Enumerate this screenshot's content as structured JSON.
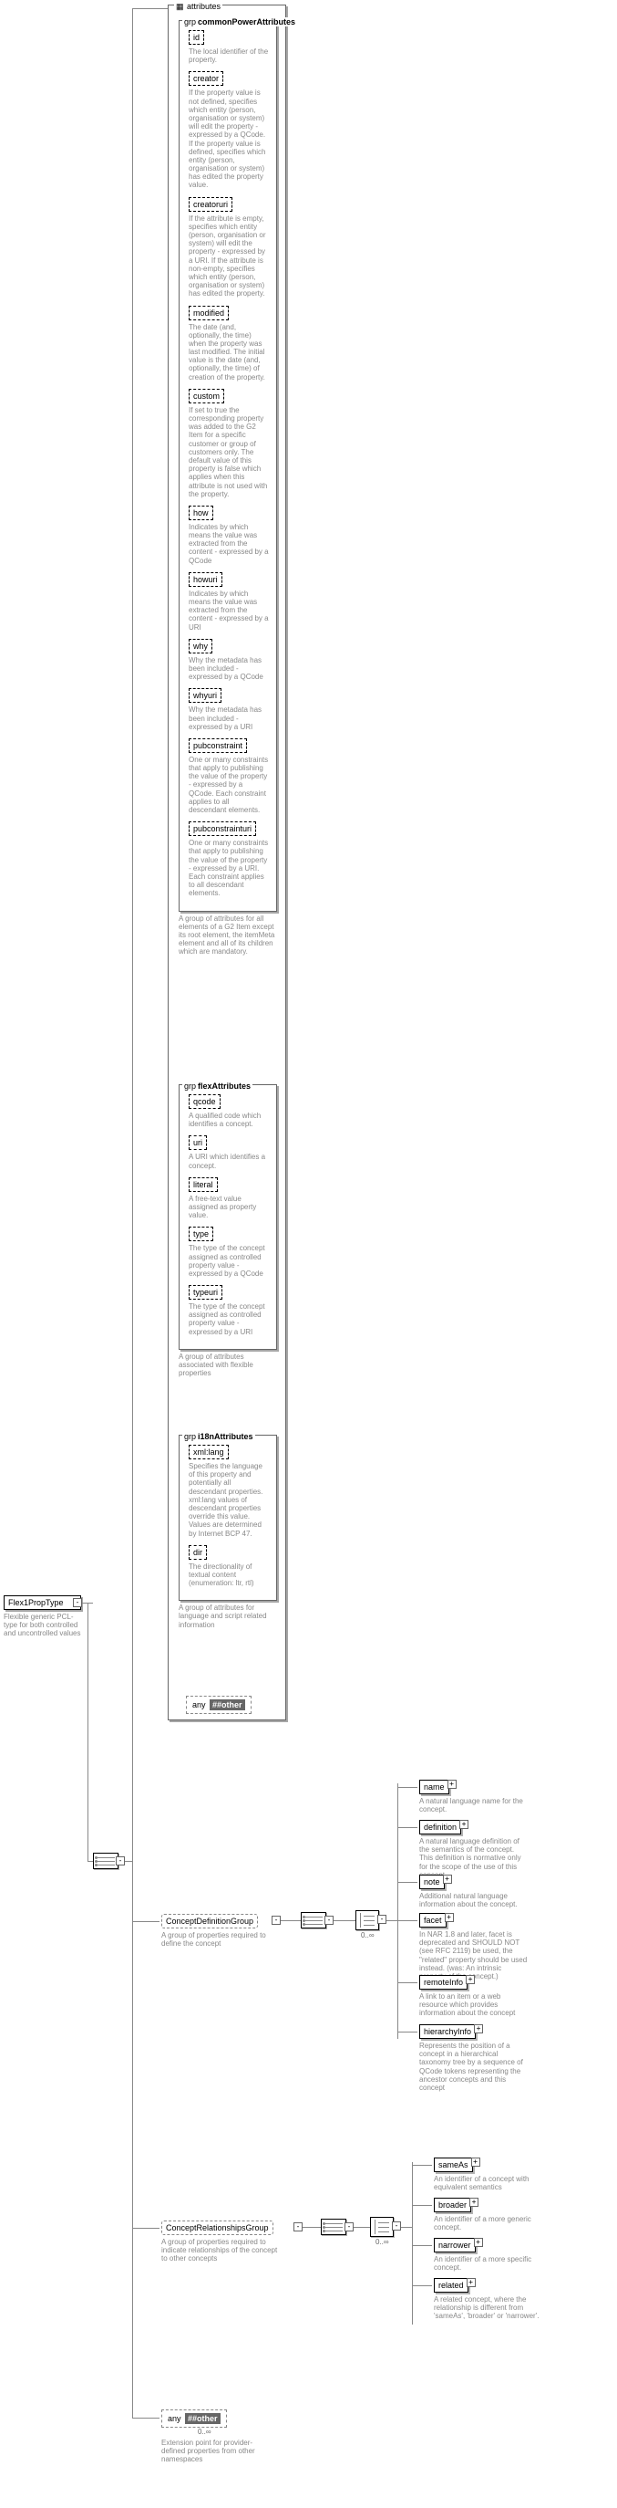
{
  "root": {
    "name": "Flex1PropType",
    "desc": "Flexible generic PCL-type for both controlled and uncontrolled values"
  },
  "attributesLabel": "attributes",
  "toggle": {
    "plus": "+",
    "minus": "-"
  },
  "groups": {
    "common": {
      "prefix": "grp",
      "name": "commonPowerAttributes",
      "desc": "A group of attributes for all elements of a G2 Item except its root element, the itemMeta element and all of its children which are mandatory.",
      "items": [
        {
          "name": "id",
          "desc": "The local identifier of the property."
        },
        {
          "name": "creator",
          "desc": "If the property value is not defined, specifies which entity (person, organisation or system) will edit the property - expressed by a QCode. If the property value is defined, specifies which entity (person, organisation or system) has edited the property value."
        },
        {
          "name": "creatoruri",
          "desc": "If the attribute is empty, specifies which entity (person, organisation or system) will edit the property - expressed by a URI. If the attribute is non-empty, specifies which entity (person, organisation or system) has edited the property."
        },
        {
          "name": "modified",
          "desc": "The date (and, optionally, the time) when the property was last modified. The initial value is the date (and, optionally, the time) of creation of the property."
        },
        {
          "name": "custom",
          "desc": "If set to true the corresponding property was added to the G2 Item for a specific customer or group of customers only. The default value of this property is false which applies when this attribute is not used with the property."
        },
        {
          "name": "how",
          "desc": "Indicates by which means the value was extracted from the content - expressed by a QCode"
        },
        {
          "name": "howuri",
          "desc": "Indicates by which means the value was extracted from the content - expressed by a URI"
        },
        {
          "name": "why",
          "desc": "Why the metadata has been included - expressed by a QCode"
        },
        {
          "name": "whyuri",
          "desc": "Why the metadata has been included - expressed by a URI"
        },
        {
          "name": "pubconstraint",
          "desc": "One or many constraints that apply to publishing the value of the property - expressed by a QCode. Each constraint applies to all descendant elements."
        },
        {
          "name": "pubconstrainturi",
          "desc": "One or many constraints that apply to publishing the value of the property - expressed by a URI. Each constraint applies to all descendant elements."
        }
      ]
    },
    "flex": {
      "prefix": "grp",
      "name": "flexAttributes",
      "desc": "A group of attributes associated with flexible properties",
      "items": [
        {
          "name": "qcode",
          "desc": "A qualified code which identifies a concept."
        },
        {
          "name": "uri",
          "desc": "A URI which identifies a concept."
        },
        {
          "name": "literal",
          "desc": "A free-text value assigned as property value."
        },
        {
          "name": "type",
          "desc": "The type of the concept assigned as controlled property value - expressed by a QCode"
        },
        {
          "name": "typeuri",
          "desc": "The type of the concept assigned as controlled property value - expressed by a URI"
        }
      ]
    },
    "i18n": {
      "prefix": "grp",
      "name": "i18nAttributes",
      "desc": "A group of attributes for language and script related information",
      "items": [
        {
          "name": "xml:lang",
          "desc": "Specifies the language of this property and potentially all descendant properties. xml:lang values of descendant properties override this value. Values are determined by Internet BCP 47."
        },
        {
          "name": "dir",
          "desc": "The directionality of textual content (enumeration: ltr, rtl)"
        }
      ]
    }
  },
  "anyOther": {
    "label": "##other",
    "prefix": "any"
  },
  "conceptDef": {
    "name": "ConceptDefinitionGroup",
    "desc": "A group of properties required to define the concept",
    "card": "0..∞",
    "items": [
      {
        "name": "name",
        "desc": "A natural language name for the concept."
      },
      {
        "name": "definition",
        "desc": "A natural language definition of the semantics of the concept. This definition is normative only for the scope of the use of this concept."
      },
      {
        "name": "note",
        "desc": "Additional natural language information about the concept."
      },
      {
        "name": "facet",
        "desc": "In NAR 1.8 and later, facet is deprecated and SHOULD NOT (see RFC 2119) be used, the \"related\" property should be used instead. (was: An intrinsic property of the concept.)"
      },
      {
        "name": "remoteInfo",
        "desc": "A link to an item or a web resource which provides information about the concept"
      },
      {
        "name": "hierarchyInfo",
        "desc": "Represents the position of a concept in a hierarchical taxonomy tree by a sequence of QCode tokens representing the ancestor concepts and this concept"
      }
    ]
  },
  "conceptRel": {
    "name": "ConceptRelationshipsGroup",
    "desc": "A group of properties required to indicate relationships of the concept to other concepts",
    "card": "0..∞",
    "items": [
      {
        "name": "sameAs",
        "desc": "An identifier of a concept with equivalent semantics"
      },
      {
        "name": "broader",
        "desc": "An identifier of a more generic concept."
      },
      {
        "name": "narrower",
        "desc": "An identifier of a more specific concept."
      },
      {
        "name": "related",
        "desc": "A related concept, where the relationship is different from 'sameAs', 'broader' or 'narrower'."
      }
    ]
  },
  "extAny": {
    "label": "##other",
    "prefix": "any",
    "card": "0..∞",
    "desc": "Extension point for provider-defined properties from other namespaces"
  }
}
